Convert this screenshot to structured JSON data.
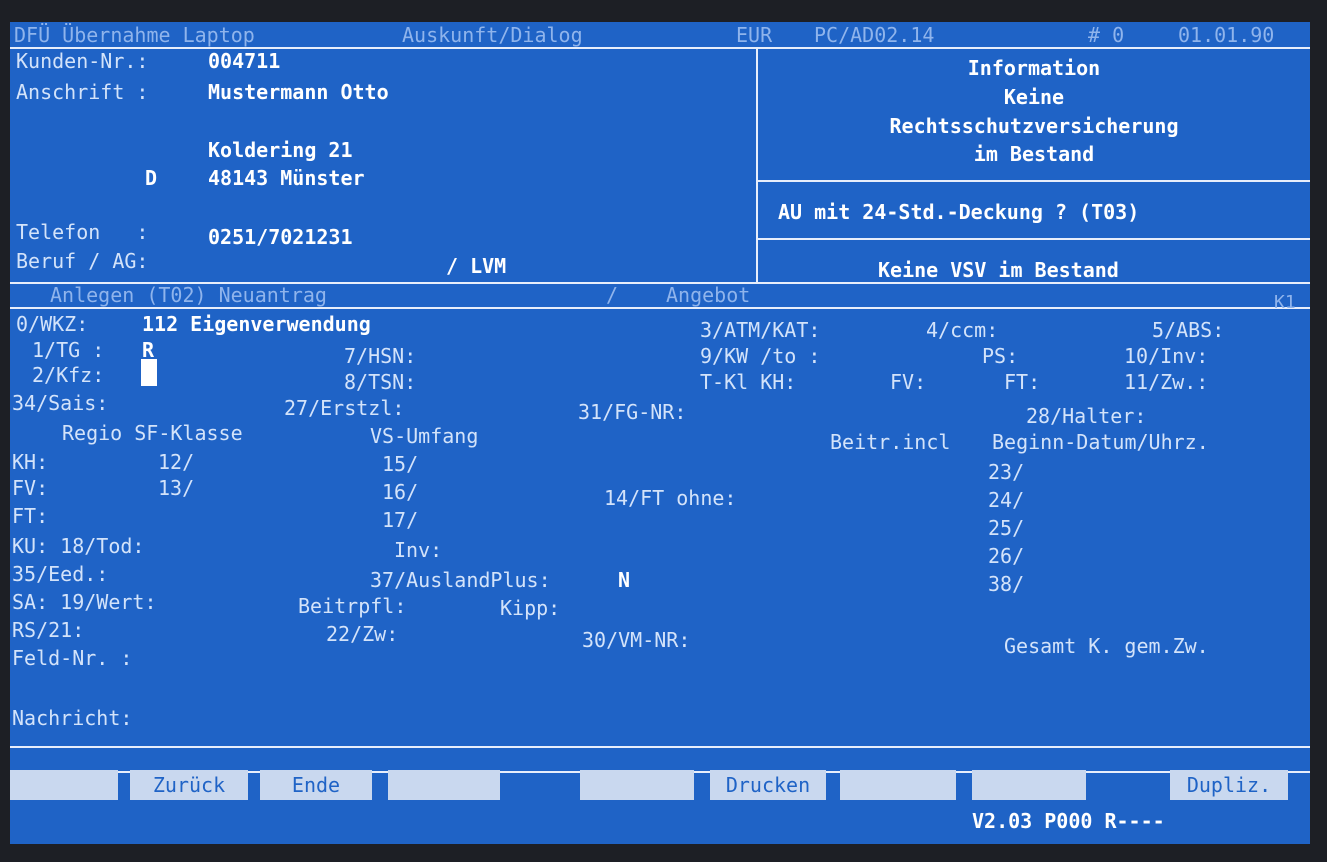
{
  "titlebar": {
    "app": "DFÜ Übernahme Laptop",
    "mode": "Auskunft/Dialog",
    "currency": "EUR",
    "program": "PC/AD02.14",
    "counter": "# 0",
    "date": "01.01.90"
  },
  "customer": {
    "kundennr_label": "Kunden-Nr.:",
    "kundennr": "004711",
    "anschrift_label": "Anschrift :",
    "name": "Mustermann Otto",
    "street": "Koldering 21",
    "country": "D",
    "city": "48143 Münster",
    "telefon_label": "Telefon   :",
    "telefon": "0251/7021231",
    "beruf_label": "Beruf / AG:",
    "beruf": "/ LVM"
  },
  "info": {
    "line1": "Information",
    "line2": "Keine",
    "line3": "Rechtsschutzversicherung",
    "line4": "im Bestand",
    "au": "AU mit 24-Std.-Deckung ? (T03)",
    "vsv": "Keine VSV im Bestand"
  },
  "section_bar": {
    "left": "Anlegen (T02) Neuantrag",
    "slash": "/",
    "mid": "Angebot",
    "right": "K1"
  },
  "form": {
    "wkz_label": "0/WKZ:",
    "wkz_value": "112 Eigenverwendung",
    "atm": "3/ATM/KAT:",
    "ccm": "4/ccm:",
    "abs": "5/ABS:",
    "tg_label": "1/TG :",
    "tg_value": "R",
    "hsn": "7/HSN:",
    "kw": "9/KW /to :",
    "ps": "PS:",
    "inv10": "10/Inv:",
    "kfz_label": "2/Kfz:",
    "tsn": "8/TSN:",
    "tkl": "T-Kl KH:",
    "fv_tkl": "FV:",
    "ft_tkl": "FT:",
    "zw11": "11/Zw.:",
    "sais": "34/Sais:",
    "erstzl": "27/Erstzl:",
    "fgnr": "31/FG-NR:",
    "halter": "28/Halter:",
    "hdr_regio": "Regio SF-Klasse",
    "hdr_vs": "VS-Umfang",
    "hdr_beitr": "Beitr.incl",
    "hdr_beginn": "Beginn-Datum/Uhrz.",
    "kh": "KH:",
    "sf12": "12/",
    "vs15": "15/",
    "b23": "23/",
    "fv": "FV:",
    "sf13": "13/",
    "vs16": "16/",
    "ft_ohne": "14/FT ohne:",
    "b24": "24/",
    "ft": "FT:",
    "vs17": "17/",
    "b25": "25/",
    "ku": "KU: 18/Tod:",
    "inv": "Inv:",
    "b26": "26/",
    "eed": "35/Eed.:",
    "ausland_label": "37/AuslandPlus:",
    "ausland_value": "N",
    "b38": "38/",
    "sa": "SA: 19/Wert:",
    "beitrpfl": "Beitrpfl:",
    "kipp": "Kipp:",
    "rs": "RS/21:",
    "zw22": "22/Zw:",
    "vmnr": "30/VM-NR:",
    "feldnr": "Feld-Nr. :",
    "gesamt": "Gesamt K. gem.Zw.",
    "nachricht": "Nachricht:"
  },
  "fkeys": {
    "zurueck": "Zurück",
    "ende": "Ende",
    "drucken": "Drucken",
    "dupliz": "Dupliz."
  },
  "version": "V2.03 P000 R----"
}
